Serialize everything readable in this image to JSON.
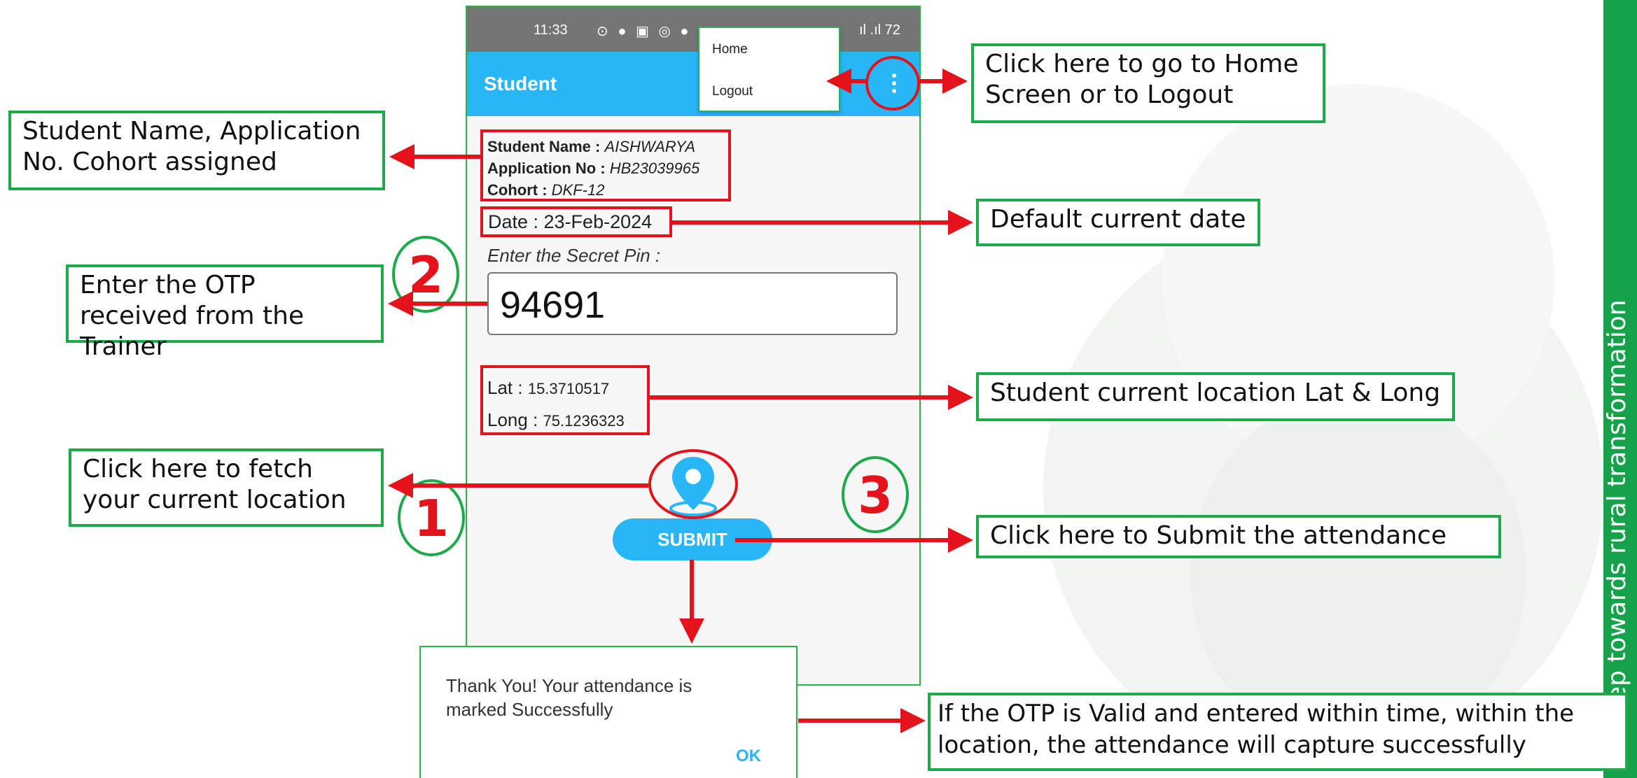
{
  "side_band_text": "A step towards rural transformation",
  "phone": {
    "status_time": "11:33",
    "status_icons": "⊙ ● ▣ ◎ ● •",
    "status_signal": "ıl .ıl 72",
    "app_title": "Student",
    "menu_items": [
      "Home",
      "Logout"
    ],
    "student_name_label": "Student Name :",
    "student_name_value": "AISHWARYA",
    "application_no_label": "Application No :",
    "application_no_value": "HB23039965",
    "cohort_label": "Cohort :",
    "cohort_value": "DKF-12",
    "date_text": "Date : 23-Feb-2024",
    "secret_pin_label": "Enter the Secret Pin :",
    "secret_pin_value": "94691",
    "lat_label": "Lat :",
    "lat_value": "15.3710517",
    "long_label": "Long :",
    "long_value": "75.1236323",
    "submit_label": "SUBMIT"
  },
  "dialog": {
    "message": "Thank You! Your attendance is marked Successfully",
    "ok_label": "OK"
  },
  "callouts": {
    "menu": "Click here to go to Home Screen or to Logout",
    "student_info": "Student Name, Application No. Cohort assigned",
    "date": "Default current date",
    "otp": "Enter the OTP received from the Trainer",
    "location": "Student current location Lat & Long",
    "fetch_location": "Click here to fetch your current location",
    "submit": "Click here to Submit the attendance",
    "result": "If the OTP is Valid and entered within time, within the location, the attendance will capture successfully"
  },
  "step_numbers": [
    "1",
    "2",
    "3"
  ],
  "colors": {
    "brand_green": "#1caa4a",
    "annotation_red": "#e3121b",
    "app_blue": "#29b6f6",
    "status_gray": "#757575"
  },
  "icons": {
    "location": "map-pin-icon",
    "menu": "kebab-menu-icon"
  }
}
